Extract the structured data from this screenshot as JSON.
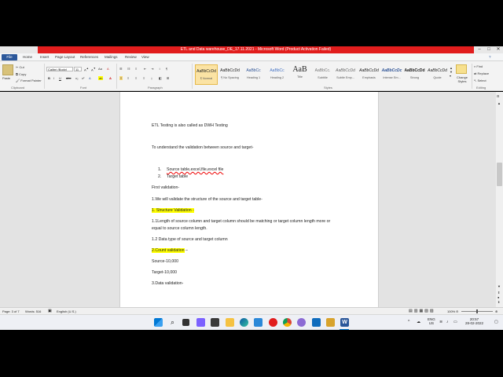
{
  "window": {
    "title": "ETL and Data warehouse_DE_17.11.2021 - Microsoft Word (Product Activation Failed)"
  },
  "tabs": [
    "File",
    "Home",
    "Insert",
    "Page Layout",
    "References",
    "Mailings",
    "Review",
    "View"
  ],
  "ribbon": {
    "clipboard": {
      "paste": "Paste",
      "cut": "Cut",
      "copy": "Copy",
      "format_painter": "Format Painter",
      "label": "Clipboard"
    },
    "font": {
      "family": "Calibri (Body)",
      "size": "11",
      "label": "Font"
    },
    "paragraph": {
      "label": "Paragraph"
    },
    "styles": {
      "label": "Styles",
      "items": [
        {
          "preview": "AaBbCcDd",
          "name": "¶ Normal"
        },
        {
          "preview": "AaBbCcDd",
          "name": "¶ No Spacing"
        },
        {
          "preview": "AaBbCc",
          "name": "Heading 1"
        },
        {
          "preview": "AaBbCc",
          "name": "Heading 2"
        },
        {
          "preview": "AaB",
          "name": "Title"
        },
        {
          "preview": "AaBbCc.",
          "name": "Subtitle"
        },
        {
          "preview": "AaBbCcDd",
          "name": "Subtle Emp..."
        },
        {
          "preview": "AaBbCcDd",
          "name": "Emphasis"
        },
        {
          "preview": "AaBbCcDc",
          "name": "Intense Em..."
        },
        {
          "preview": "AaBbCcDd",
          "name": "Strong"
        },
        {
          "preview": "AaBbCcDd",
          "name": "Quote"
        }
      ],
      "change_styles": "Change Styles"
    },
    "editing": {
      "find": "Find",
      "replace": "Replace",
      "select": "Select",
      "label": "Editing"
    }
  },
  "document": {
    "lines": [
      "ETL Testing is also called as DWH Testing",
      "To understand  the validation between source and target-",
      "1.",
      "Source table,excel,file,excel file",
      "2.",
      "Target table",
      "First validation-",
      "1.We will validate  the structure of the source and target table-",
      "1. Structure  Validation -",
      "1.1Length of source column and target column should be matching  or target column length more or",
      "equal to source column length.",
      "1.2 Data type of source and target column",
      "2.Count validation",
      " –",
      "Source-10,000",
      "Target-10,000",
      "3.Data validation-"
    ]
  },
  "status": {
    "page": "Page: 3 of 7",
    "words": "Words: 516",
    "language": "English (U.S.)",
    "zoom": "100%"
  },
  "taskbar": {
    "lang": "ENG",
    "region": "US",
    "time": "20:57",
    "date": "28-02-2022"
  }
}
